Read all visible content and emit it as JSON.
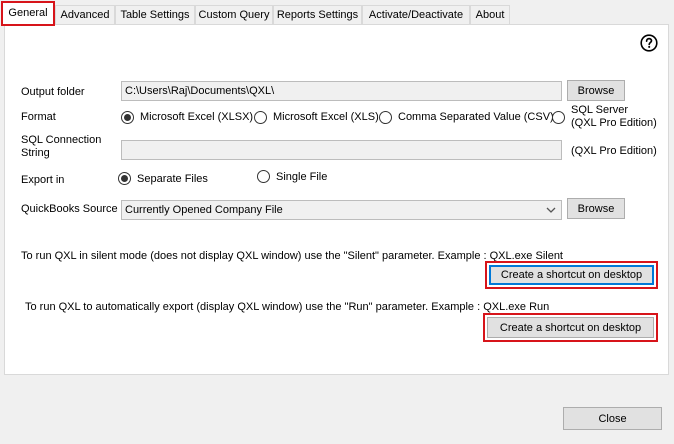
{
  "tabs": [
    "General",
    "Advanced",
    "Table Settings",
    "Custom Query",
    "Reports Settings",
    "Activate/Deactivate",
    "About"
  ],
  "active_tab": "General",
  "help_icon": "question-circle-icon",
  "output_folder": {
    "label": "Output folder",
    "value": "C:\\Users\\Raj\\Documents\\QXL\\",
    "browse": "Browse"
  },
  "format": {
    "label": "Format",
    "options": [
      "Microsoft Excel (XLSX)",
      "Microsoft Excel (XLS)",
      "Comma Separated Value (CSV)"
    ],
    "selected": "Microsoft Excel (XLSX)",
    "sql_server_line1": "SQL Server",
    "sql_server_line2": "(QXL Pro Edition)"
  },
  "sql_connection": {
    "label_line1": "SQL Connection",
    "label_line2": "String",
    "value": "",
    "note": "(QXL Pro Edition)"
  },
  "export_in": {
    "label": "Export in",
    "options": [
      "Separate Files",
      "Single File"
    ],
    "selected": "Separate Files"
  },
  "qb_source": {
    "label": "QuickBooks Source",
    "value": "Currently Opened Company File",
    "browse": "Browse"
  },
  "silent": {
    "text": "To run QXL in silent mode (does not display QXL window) use the \"Silent\" parameter. Example :  QXL.exe Silent",
    "button": "Create a shortcut on desktop"
  },
  "run": {
    "text": "To run QXL to automatically export (display QXL window) use the \"Run\" parameter. Example :  QXL.exe Run",
    "button": "Create a shortcut on desktop"
  },
  "close_button": "Close",
  "colors": {
    "highlight": "#d7141a",
    "focus": "#0078d7"
  }
}
